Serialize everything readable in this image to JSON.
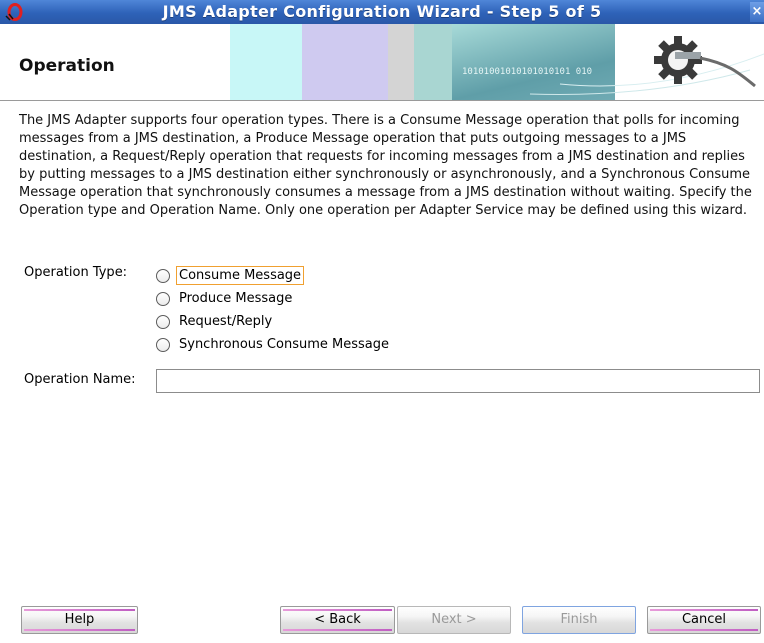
{
  "window": {
    "title": "JMS Adapter Configuration Wizard - Step 5 of 5",
    "close_glyph": "×"
  },
  "header": {
    "page_title": "Operation",
    "banner_text": "10101001010101010101  010"
  },
  "description": "The JMS Adapter supports four operation types.  There is a Consume Message operation that polls for incoming messages from a JMS destination, a Produce Message operation that puts outgoing messages to a JMS destination, a Request/Reply operation that requests for incoming messages from a JMS destination and replies by putting messages to a JMS destination either synchronously or asynchronously, and a Synchronous Consume Message operation that synchronously consumes a message from a JMS destination without waiting.  Specify the Operation type and Operation Name.  Only one operation per Adapter Service may be defined using this wizard.",
  "form": {
    "operation_type_label": "Operation Type:",
    "operation_types": [
      {
        "label": "Consume Message",
        "selected": false,
        "focused": true
      },
      {
        "label": "Produce Message",
        "selected": false,
        "focused": false
      },
      {
        "label": "Request/Reply",
        "selected": false,
        "focused": false
      },
      {
        "label": "Synchronous Consume Message",
        "selected": false,
        "focused": false
      }
    ],
    "operation_name_label": "Operation Name:",
    "operation_name_value": ""
  },
  "buttons": {
    "help": "Help",
    "back": "< Back",
    "next": "Next >",
    "finish": "Finish",
    "cancel": "Cancel"
  },
  "colors": {
    "titlebar": "#2e62b8",
    "focus_outline": "#f0a030",
    "button_accent": "#c05ec2"
  }
}
